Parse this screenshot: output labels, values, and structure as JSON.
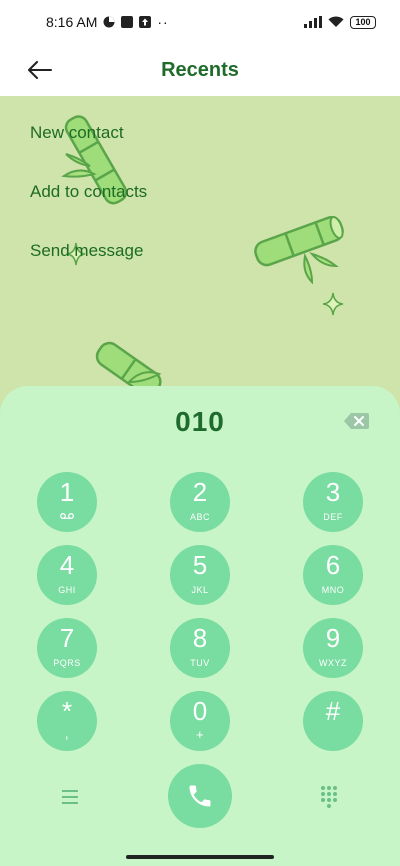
{
  "status": {
    "time": "8:16 AM",
    "dots": "··",
    "battery": "100"
  },
  "header": {
    "title": "Recents",
    "back_icon": "arrow-left-icon"
  },
  "menu": {
    "items": [
      {
        "label": "New contact"
      },
      {
        "label": "Add to contacts"
      },
      {
        "label": "Send message"
      }
    ]
  },
  "dialer": {
    "number": "010",
    "keys": [
      {
        "digit": "1",
        "letters": ""
      },
      {
        "digit": "2",
        "letters": "ABC"
      },
      {
        "digit": "3",
        "letters": "DEF"
      },
      {
        "digit": "4",
        "letters": "GHI"
      },
      {
        "digit": "5",
        "letters": "JKL"
      },
      {
        "digit": "6",
        "letters": "MNO"
      },
      {
        "digit": "7",
        "letters": "PQRS"
      },
      {
        "digit": "8",
        "letters": "TUV"
      },
      {
        "digit": "9",
        "letters": "WXYZ"
      },
      {
        "digit": "*",
        "letters": ","
      },
      {
        "digit": "0",
        "letters": "+"
      },
      {
        "digit": "#",
        "letters": ""
      }
    ]
  },
  "colors": {
    "accent": "#1e6b2e",
    "key_fill": "#79dca0",
    "sheet_bg": "#c7f5c8",
    "page_bg": "#cfe4ab"
  }
}
